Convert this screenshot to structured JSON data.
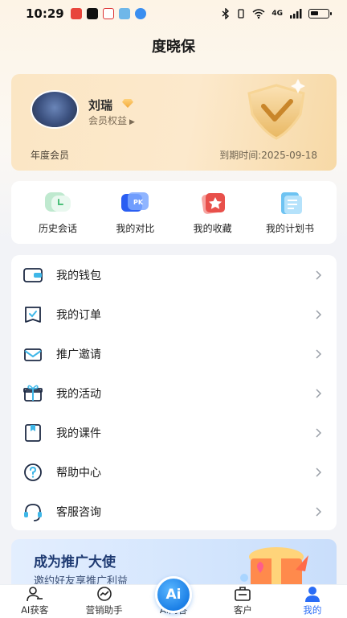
{
  "status_bar": {
    "time": "10:29",
    "network": "4G"
  },
  "header": {
    "title": "度晓保"
  },
  "member_card": {
    "user_name": "刘瑞",
    "benefit_link": "会员权益",
    "member_type": "年度会员",
    "expiry": "到期时间:2025-09-18"
  },
  "quick_actions": [
    {
      "label": "历史会话",
      "icon": "history-chat-icon"
    },
    {
      "label": "我的对比",
      "icon": "compare-icon"
    },
    {
      "label": "我的收藏",
      "icon": "favorites-icon"
    },
    {
      "label": "我的计划书",
      "icon": "plan-book-icon"
    }
  ],
  "menu": [
    {
      "label": "我的钱包",
      "icon": "wallet-icon"
    },
    {
      "label": "我的订单",
      "icon": "order-icon"
    },
    {
      "label": "推广邀请",
      "icon": "invite-icon"
    },
    {
      "label": "我的活动",
      "icon": "activity-icon"
    },
    {
      "label": "我的课件",
      "icon": "courseware-icon"
    },
    {
      "label": "帮助中心",
      "icon": "help-icon"
    },
    {
      "label": "客服咨询",
      "icon": "customer-service-icon"
    }
  ],
  "promo": {
    "title": "成为推广大使",
    "subtitle": "邀约好友享推广利益"
  },
  "tab_bar": {
    "tabs": [
      {
        "label": "AI获客",
        "icon": "user-acquire-icon"
      },
      {
        "label": "营销助手",
        "icon": "marketing-icon"
      },
      {
        "label": "AI问答",
        "icon": "ai-qa-icon"
      },
      {
        "label": "客户",
        "icon": "customer-icon"
      },
      {
        "label": "我的",
        "icon": "me-icon"
      }
    ],
    "active_index": 4,
    "center_badge": "Ai"
  },
  "colors": {
    "accent": "#2a6cf6",
    "gold": "#f2b44a"
  }
}
